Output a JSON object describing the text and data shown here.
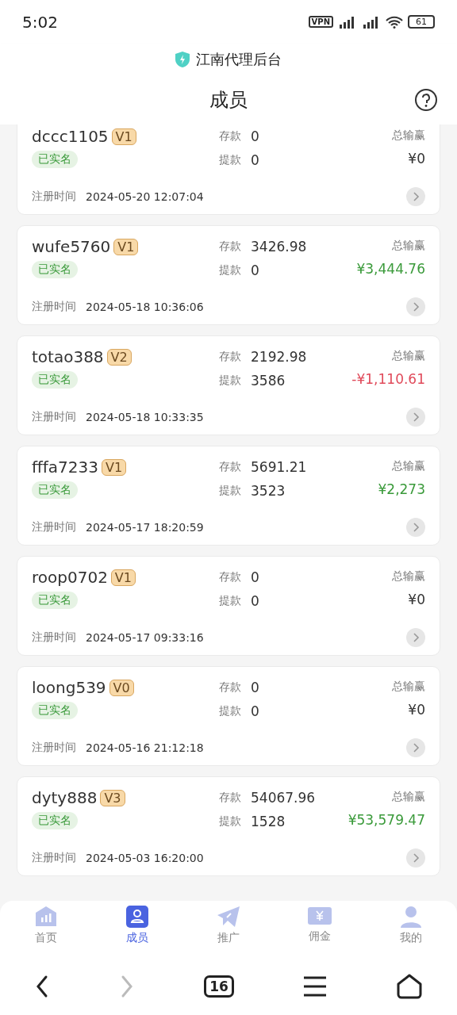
{
  "status_bar": {
    "time": "5:02",
    "vpn": "VPN",
    "battery": "61"
  },
  "app_bar": {
    "title": "江南代理后台"
  },
  "header": {
    "title": "成员"
  },
  "members": [
    {
      "name": "dccc1105",
      "level_tag": "V1",
      "verified": "已实名",
      "deposit_label": "存款",
      "deposit": "0",
      "withdraw_label": "提款",
      "withdraw": "0",
      "total_label": "总输赢",
      "total": "¥0",
      "color": "#333333",
      "reg_label": "注册时间",
      "reg_time": "2024-05-20 12:07:04"
    },
    {
      "name": "wufe5760",
      "level_tag": "V1",
      "verified": "已实名",
      "deposit_label": "存款",
      "deposit": "3426.98",
      "withdraw_label": "提款",
      "withdraw": "0",
      "total_label": "总输赢",
      "total": "¥3,444.76",
      "color": "#3a9a3a",
      "reg_label": "注册时间",
      "reg_time": "2024-05-18 10:36:06"
    },
    {
      "name": "totao388",
      "level_tag": "V2",
      "verified": "已实名",
      "deposit_label": "存款",
      "deposit": "2192.98",
      "withdraw_label": "提款",
      "withdraw": "3586",
      "total_label": "总输赢",
      "total": "-¥1,110.61",
      "color": "#e04a5a",
      "reg_label": "注册时间",
      "reg_time": "2024-05-18 10:33:35"
    },
    {
      "name": "fffa7233",
      "level_tag": "V1",
      "verified": "已实名",
      "deposit_label": "存款",
      "deposit": "5691.21",
      "withdraw_label": "提款",
      "withdraw": "3523",
      "total_label": "总输赢",
      "total": "¥2,273",
      "color": "#3a9a3a",
      "reg_label": "注册时间",
      "reg_time": "2024-05-17 18:20:59"
    },
    {
      "name": "roop0702",
      "level_tag": "V1",
      "verified": "已实名",
      "deposit_label": "存款",
      "deposit": "0",
      "withdraw_label": "提款",
      "withdraw": "0",
      "total_label": "总输赢",
      "total": "¥0",
      "color": "#333333",
      "reg_label": "注册时间",
      "reg_time": "2024-05-17 09:33:16"
    },
    {
      "name": "loong539",
      "level_tag": "V0",
      "verified": "已实名",
      "deposit_label": "存款",
      "deposit": "0",
      "withdraw_label": "提款",
      "withdraw": "0",
      "total_label": "总输赢",
      "total": "¥0",
      "color": "#333333",
      "reg_label": "注册时间",
      "reg_time": "2024-05-16 21:12:18"
    },
    {
      "name": "dyty888",
      "level_tag": "V3",
      "verified": "已实名",
      "deposit_label": "存款",
      "deposit": "54067.96",
      "withdraw_label": "提款",
      "withdraw": "1528",
      "total_label": "总输赢",
      "total": "¥53,579.47",
      "color": "#3a9a3a",
      "reg_label": "注册时间",
      "reg_time": "2024-05-03 16:20:00"
    }
  ],
  "tab_bar": [
    {
      "label": "首页",
      "kind": "home",
      "selected": false
    },
    {
      "label": "成员",
      "kind": "members",
      "selected": true
    },
    {
      "label": "推广",
      "kind": "promote",
      "selected": false
    },
    {
      "label": "佣金",
      "kind": "commission",
      "selected": false
    },
    {
      "label": "我的",
      "kind": "profile",
      "selected": false
    }
  ],
  "system_nav": {
    "tabs_count": "16"
  }
}
